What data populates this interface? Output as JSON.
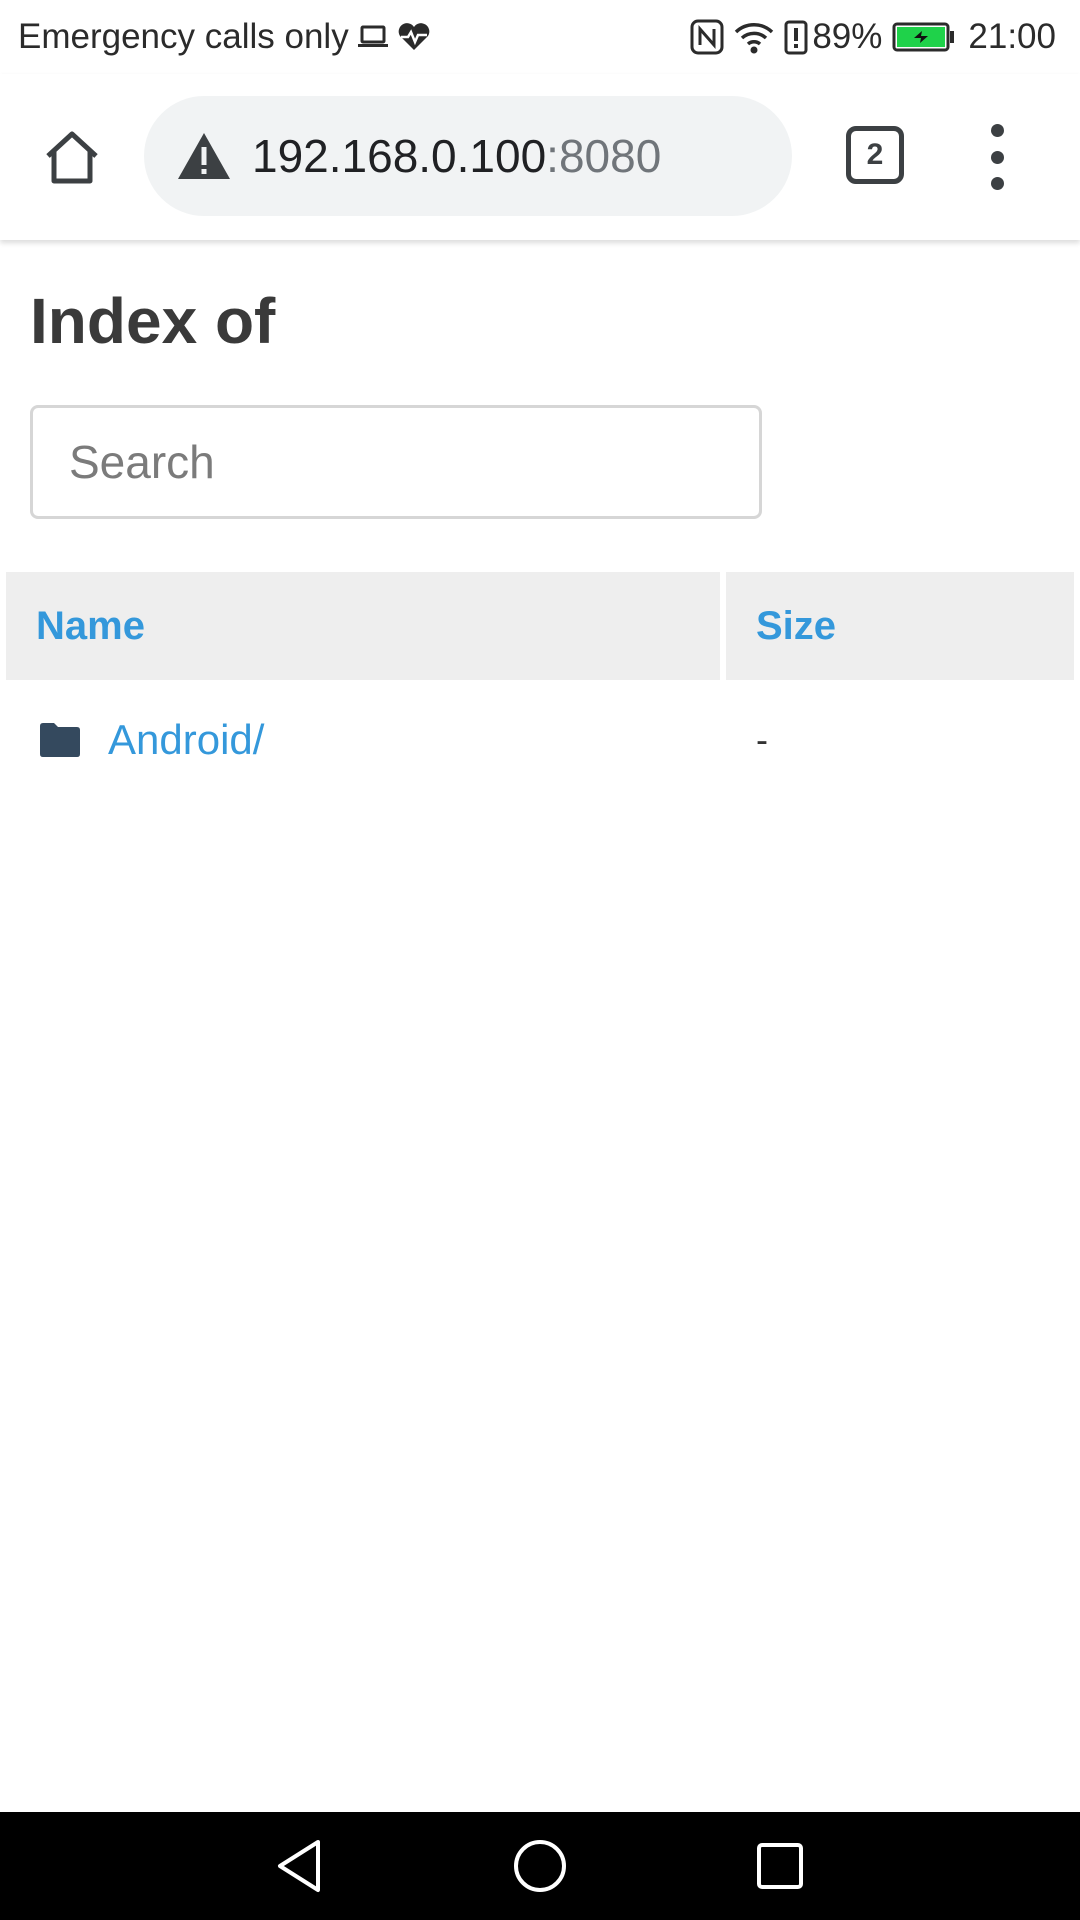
{
  "status_bar": {
    "carrier_text": "Emergency calls only",
    "battery_percent": "89%",
    "time": "21:00",
    "icons": [
      "laptop-icon",
      "heart-rate-icon",
      "nfc-icon",
      "wifi-icon",
      "battery-alert-icon",
      "battery-charging-icon"
    ]
  },
  "browser": {
    "url_host": "192.168.0.100",
    "url_port": ":8080",
    "tab_count": "2",
    "icons": [
      "home-icon",
      "not-secure-warning-icon",
      "more-menu-icon"
    ]
  },
  "page": {
    "title": "Index of",
    "search_placeholder": "Search",
    "table": {
      "headers": {
        "name": "Name",
        "size": "Size"
      },
      "rows": [
        {
          "name": "Android/",
          "size": "-",
          "icon": "folder-icon"
        }
      ]
    }
  },
  "nav_bar": {
    "icons": [
      "back-icon",
      "home-circle-icon",
      "recents-icon"
    ]
  },
  "colors": {
    "link": "#3498db",
    "header_bg": "#eeeeee",
    "omnibox_bg": "#f1f3f4",
    "folder": "#34495e",
    "battery_green": "#1fd24a"
  }
}
